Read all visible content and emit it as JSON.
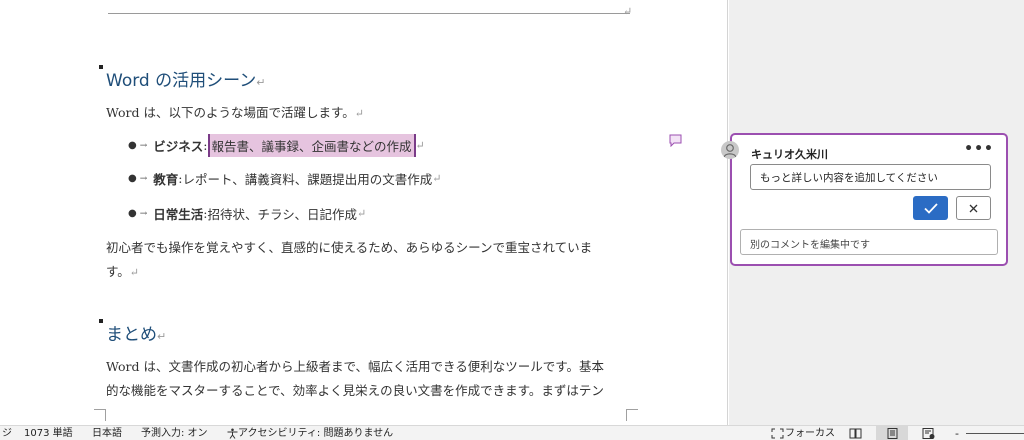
{
  "document": {
    "headings": {
      "usage": "Word の活用シーン",
      "summary": "まとめ"
    },
    "intro": "Word は、以下のような場面で活躍します。",
    "bullets": [
      {
        "term": "ビジネス",
        "sep": ":",
        "desc": "報告書、議事録、企画書などの作成"
      },
      {
        "term": "教育",
        "sep": ":",
        "desc": " レポート、講義資料、課題提出用の文書作成"
      },
      {
        "term": "日常生活",
        "sep": ":",
        "desc": " 招待状、チラシ、日記作成"
      }
    ],
    "paragraph1_line1": "初心者でも操作を覚えやすく、直感的に使えるため、あらゆるシーンで重宝されていま",
    "paragraph1_line2": "す。",
    "paragraph2_line1": "Word は、文書作成の初心者から上級者まで、幅広く活用できる便利なツールです。基本",
    "paragraph2_line2": "的な機能をマスターすることで、効率よく見栄えの良い文書を作成できます。まずはテン",
    "paragraph_mark": "↵"
  },
  "comment": {
    "author": "キュリオ久米川",
    "more_label": "•••",
    "draft_text": "もっと詳しい内容を追加してください",
    "reply_placeholder": "別のコメントを編集中です"
  },
  "statusbar": {
    "page_fragment": "ジ",
    "word_count": "1073 単語",
    "language": "日本語",
    "predictive": "予測入力: オン",
    "accessibility": "アクセシビリティ: 問題ありません",
    "focus": "フォーカス",
    "zoom_minus": "-"
  },
  "colors": {
    "heading": "#1f4e79",
    "comment_border": "#9b4fb0",
    "highlight": "#e6c4df",
    "confirm_button": "#2b6cc4"
  },
  "icons": {
    "comment_marker": "speech-bubble-icon",
    "confirm": "checkmark-icon",
    "cancel": "close-icon",
    "avatar": "person-icon",
    "accessibility": "accessibility-icon",
    "focus": "focus-icon",
    "views": [
      "read-mode-icon",
      "print-layout-icon",
      "web-layout-icon"
    ]
  }
}
